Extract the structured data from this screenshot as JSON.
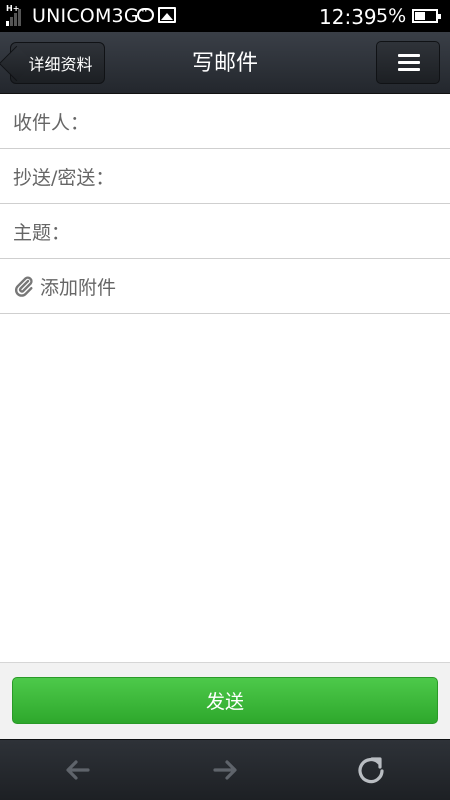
{
  "status_bar": {
    "carrier": "UNICOM3G",
    "time": "12:39",
    "battery_pct": "5%",
    "battery_level": 0.05,
    "network_type": "H+",
    "icons": [
      "signal-icon",
      "chat-notification-icon",
      "image-notification-icon",
      "battery-icon"
    ]
  },
  "header": {
    "back_label": "详细资料",
    "title": "写邮件",
    "menu_icon": "hamburger-menu-icon"
  },
  "form": {
    "to_label": "收件人：",
    "cc_bcc_label": "抄送/密送：",
    "subject_label": "主题：",
    "attach_label": "添加附件",
    "attach_icon": "paperclip-icon"
  },
  "actions": {
    "send_label": "发送",
    "send_color": "#3bb838"
  },
  "bottom_nav": {
    "icons": [
      "back-arrow-icon",
      "forward-arrow-icon",
      "refresh-icon"
    ]
  }
}
